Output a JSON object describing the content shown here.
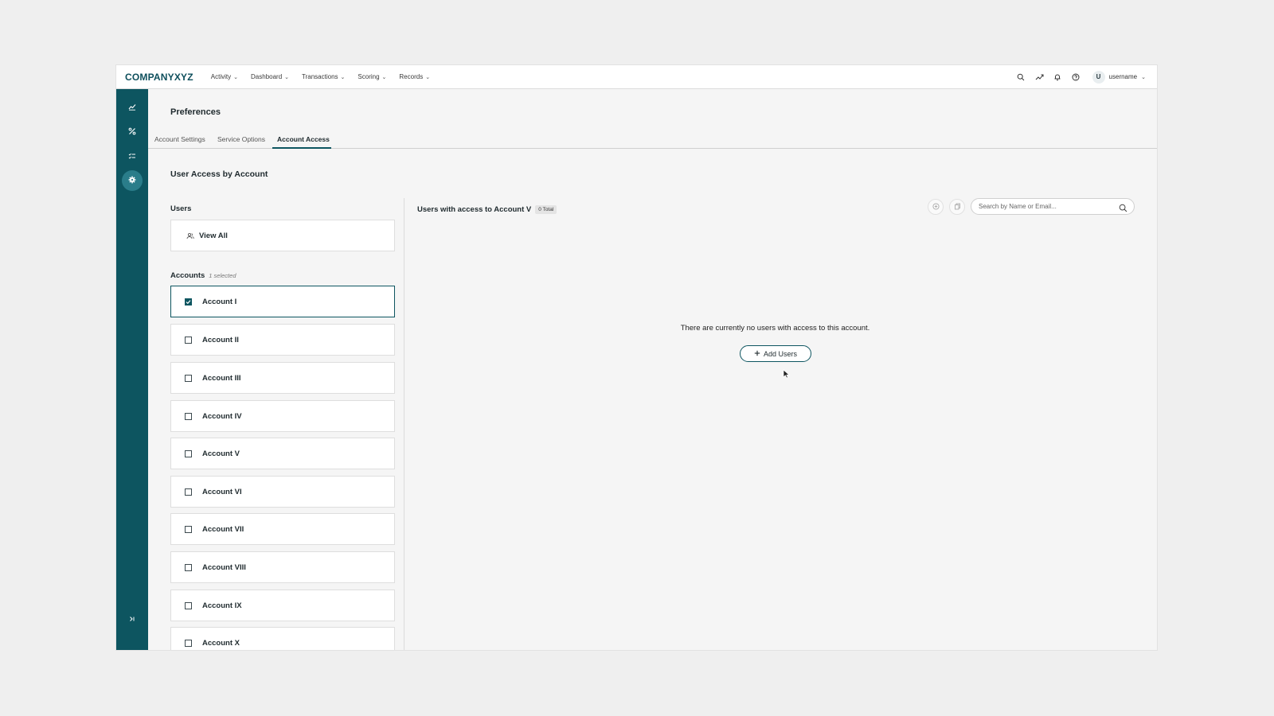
{
  "brand": "COMPANYXYZ",
  "nav": [
    {
      "label": "Activity"
    },
    {
      "label": "Dashboard"
    },
    {
      "label": "Transactions"
    },
    {
      "label": "Scoring"
    },
    {
      "label": "Records"
    }
  ],
  "user": {
    "initial": "U",
    "name": "username"
  },
  "page_title": "Preferences",
  "tabs": [
    {
      "label": "Account Settings"
    },
    {
      "label": "Service Options"
    },
    {
      "label": "Account Access"
    }
  ],
  "section_title": "User Access by Account",
  "users_panel": {
    "label": "Users",
    "view_all": "View All"
  },
  "accounts_panel": {
    "label": "Accounts",
    "selected_count": "1 selected",
    "items": [
      {
        "label": "Account I",
        "checked": true
      },
      {
        "label": "Account II",
        "checked": false
      },
      {
        "label": "Account III",
        "checked": false
      },
      {
        "label": "Account IV",
        "checked": false
      },
      {
        "label": "Account V",
        "checked": false
      },
      {
        "label": "Account VI",
        "checked": false
      },
      {
        "label": "Account VII",
        "checked": false
      },
      {
        "label": "Account VIII",
        "checked": false
      },
      {
        "label": "Account IX",
        "checked": false
      },
      {
        "label": "Account X",
        "checked": false
      }
    ]
  },
  "right_panel": {
    "title": "Users with access to Account V",
    "total_badge": "0 Total",
    "search_placeholder": "Search by Name or Email...",
    "empty_message": "There are currently no users with access to this account.",
    "add_users_label": "Add Users"
  },
  "colors": {
    "primary": "#0d5560",
    "rail_active": "#2a7d8a",
    "background": "#f5f5f5"
  },
  "icons": [
    "chart-icon",
    "percent-icon",
    "checklist-icon",
    "gear-icon",
    "expand-rail-icon",
    "search-icon",
    "trending-icon",
    "bell-icon",
    "help-icon",
    "users-icon",
    "add-circle-icon",
    "copy-icon",
    "plus-icon",
    "cursor-icon"
  ]
}
